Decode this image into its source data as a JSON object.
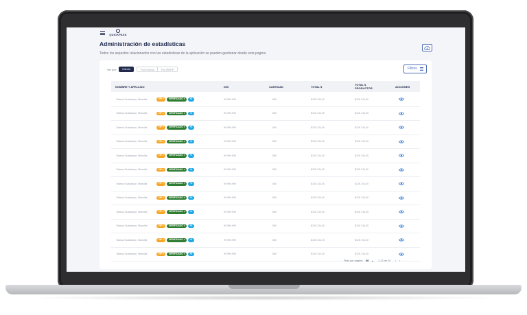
{
  "app": {
    "logo_text": "QUICKPASS"
  },
  "header": {
    "title": "Administración de estadísticas",
    "subtitle": "Todos los aspectos relacionados con las estadísticas de la aplicación se pueden gestionar desde esta pagina"
  },
  "filters": {
    "label": "Ver por:",
    "options": [
      "Cliente",
      "Por Evento",
      "Por RRPP"
    ],
    "button_label": "Filtros"
  },
  "table": {
    "columns": [
      "NOMBRE Y  APELLIDO",
      "DNI",
      "CANTIDAD",
      "TOTAL $",
      "TOTAL $ PRODUCTOR",
      "ACCIONES"
    ],
    "badges": {
      "vip": "VIP",
      "verified": "VERIFICADO",
      "extra": "+1"
    },
    "rows": [
      {
        "name": "Tatiana Guadalupe, Mansilla",
        "dni": "99.999.999",
        "qty": "560",
        "total": "$126.744,00",
        "total_prod": "$126.744,00"
      },
      {
        "name": "Tatiana Guadalupe, Mansilla",
        "dni": "99.999.999",
        "qty": "560",
        "total": "$126.744,00",
        "total_prod": "$126.744,00"
      },
      {
        "name": "Tatiana Guadalupe, Mansilla",
        "dni": "99.999.999",
        "qty": "560",
        "total": "$126.744,00",
        "total_prod": "$126.744,00"
      },
      {
        "name": "Tatiana Guadalupe, Mansilla",
        "dni": "99.999.999",
        "qty": "560",
        "total": "$126.744,00",
        "total_prod": "$126.744,00"
      },
      {
        "name": "Tatiana Guadalupe, Mansilla",
        "dni": "99.999.999",
        "qty": "560",
        "total": "$126.744,00",
        "total_prod": "$126.744,00"
      },
      {
        "name": "Tatiana Guadalupe, Mansilla",
        "dni": "99.999.999",
        "qty": "560",
        "total": "$126.744,00",
        "total_prod": "$126.744,00"
      },
      {
        "name": "Tatiana Guadalupe, Mansilla",
        "dni": "99.999.999",
        "qty": "560",
        "total": "$126.744,00",
        "total_prod": "$126.744,00"
      },
      {
        "name": "Tatiana Guadalupe, Mansilla",
        "dni": "99.999.999",
        "qty": "560",
        "total": "$126.744,00",
        "total_prod": "$126.744,00"
      },
      {
        "name": "Tatiana Guadalupe, Mansilla",
        "dni": "99.999.999",
        "qty": "560",
        "total": "$126.744,00",
        "total_prod": "$126.744,00"
      },
      {
        "name": "Tatiana Guadalupe, Mansilla",
        "dni": "99.999.999",
        "qty": "560",
        "total": "$126.744,00",
        "total_prod": "$126.744,00"
      },
      {
        "name": "Tatiana Guadalupe, Mansilla",
        "dni": "99.999.999",
        "qty": "560",
        "total": "$126.744,00",
        "total_prod": "$126.744,00"
      },
      {
        "name": "Tatiana Guadalupe, Mansilla",
        "dni": "99.999.999",
        "qty": "560",
        "total": "$126.744,00",
        "total_prod": "$126.744,00"
      }
    ]
  },
  "pagination": {
    "rows_per_page_label": "Filas por pagina:",
    "rows_per_page": "48",
    "range": "1-12 de 24"
  },
  "colors": {
    "primary": "#1f2a4d",
    "accent": "#4b6cb7",
    "vip": "#f5a623",
    "verified": "#2e7d32",
    "extra": "#1ea7e1"
  }
}
